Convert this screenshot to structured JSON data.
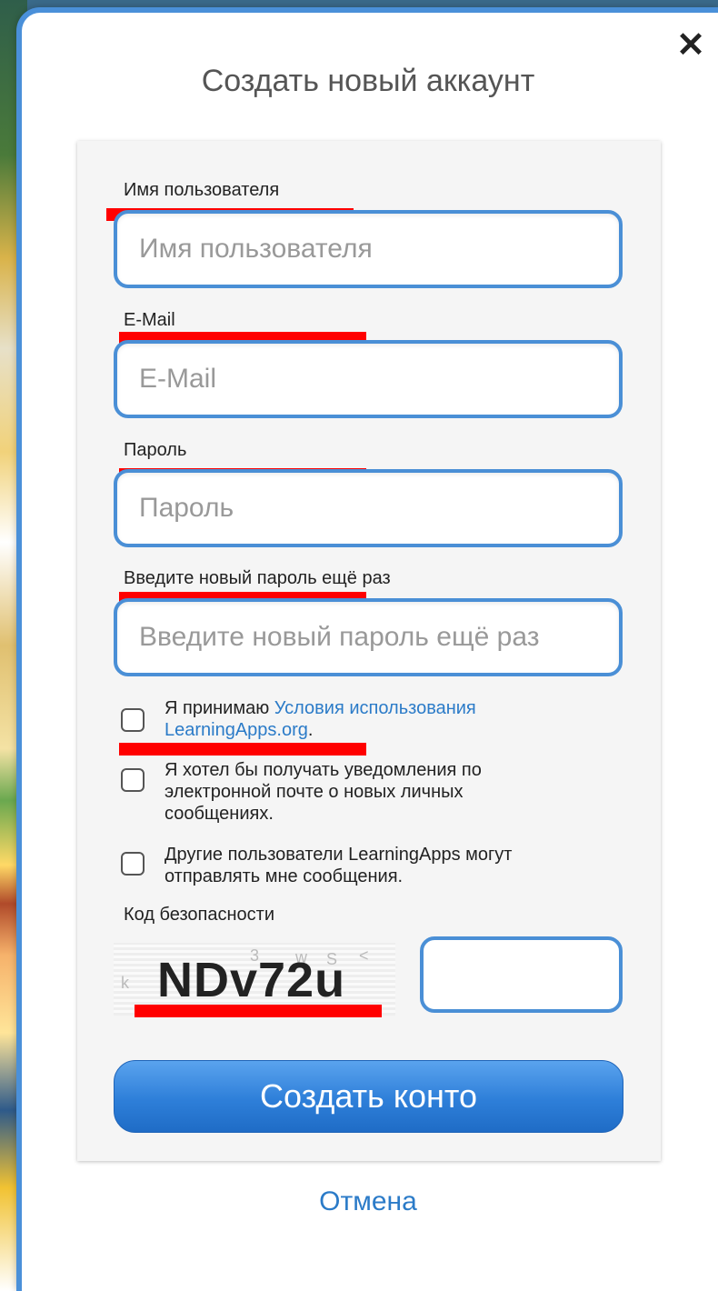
{
  "dialog": {
    "title": "Создать новый аккаунт",
    "close_symbol": "✕"
  },
  "fields": {
    "username": {
      "label": "Имя пользователя",
      "placeholder": "Имя пользователя",
      "value": ""
    },
    "email": {
      "label": "E-Mail",
      "placeholder": "E-Mail",
      "value": ""
    },
    "password": {
      "label": "Пароль",
      "placeholder": "Пароль",
      "value": ""
    },
    "password_repeat": {
      "label": "Введите новый пароль ещё раз",
      "placeholder": "Введите новый пароль ещё раз",
      "value": ""
    }
  },
  "checkboxes": {
    "terms": {
      "prefix": "Я принимаю ",
      "link": "Условия использования LearningApps.org",
      "suffix": ".",
      "checked": false
    },
    "email_notify": {
      "label": "Я хотел бы получать уведомления по электронной почте о новых личных сообщениях.",
      "checked": false
    },
    "allow_messages": {
      "label": "Другие пользователи LearningApps могут отправлять мне сообщения.",
      "checked": false
    }
  },
  "captcha": {
    "label": "Код безопасности",
    "code": "NDv72u",
    "value": ""
  },
  "actions": {
    "submit_label": "Создать конто",
    "cancel_label": "Отмена"
  },
  "colors": {
    "accent": "#4a8fd6",
    "link": "#2b7bc8",
    "redaction": "#ff0000"
  }
}
